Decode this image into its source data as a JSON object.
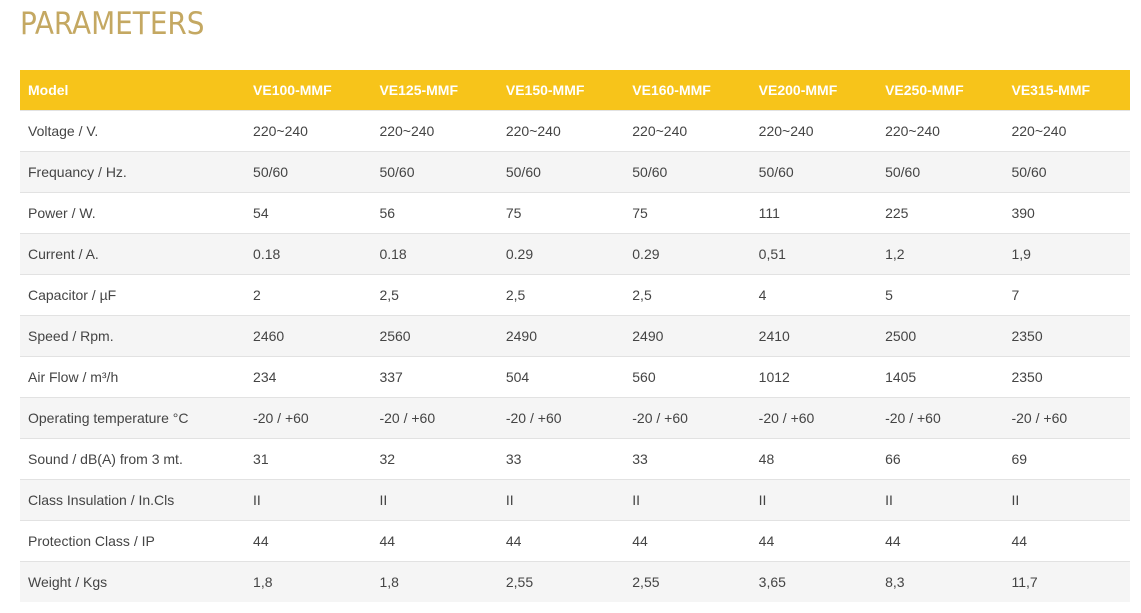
{
  "title": "PARAMETERS",
  "accent_color": "#f7c41a",
  "title_color": "#c4a862",
  "table": {
    "header": [
      "Model",
      "VE100-MMF",
      "VE125-MMF",
      "VE150-MMF",
      "VE160-MMF",
      "VE200-MMF",
      "VE250-MMF",
      "VE315-MMF"
    ],
    "rows": [
      [
        "Voltage / V.",
        "220~240",
        "220~240",
        "220~240",
        "220~240",
        "220~240",
        "220~240",
        "220~240"
      ],
      [
        "Frequancy / Hz.",
        "50/60",
        "50/60",
        "50/60",
        "50/60",
        "50/60",
        "50/60",
        "50/60"
      ],
      [
        "Power / W.",
        "54",
        "56",
        "75",
        "75",
        "111",
        "225",
        "390"
      ],
      [
        "Current / A.",
        "0.18",
        "0.18",
        "0.29",
        "0.29",
        "0,51",
        "1,2",
        "1,9"
      ],
      [
        "Capacitor / µF",
        "2",
        "2,5",
        "2,5",
        "2,5",
        "4",
        "5",
        "7"
      ],
      [
        "Speed / Rpm.",
        "2460",
        "2560",
        "2490",
        "2490",
        "2410",
        "2500",
        "2350"
      ],
      [
        "Air Flow / m³/h",
        "234",
        "337",
        "504",
        "560",
        "1012",
        "1405",
        "2350"
      ],
      [
        "Operating temperature °C",
        "-20 / +60",
        "-20 / +60",
        "-20 / +60",
        "-20 / +60",
        "-20 / +60",
        "-20 / +60",
        "-20 / +60"
      ],
      [
        "Sound / dB(A) from 3 mt.",
        "31",
        "32",
        "33",
        "33",
        "48",
        "66",
        "69"
      ],
      [
        "Class Insulation / In.Cls",
        "II",
        "II",
        "II",
        "II",
        "II",
        "II",
        "II"
      ],
      [
        "Protection Class / IP",
        "44",
        "44",
        "44",
        "44",
        "44",
        "44",
        "44"
      ],
      [
        "Weight / Kgs",
        "1,8",
        "1,8",
        "2,55",
        "2,55",
        "3,65",
        "8,3",
        "11,7"
      ]
    ]
  }
}
